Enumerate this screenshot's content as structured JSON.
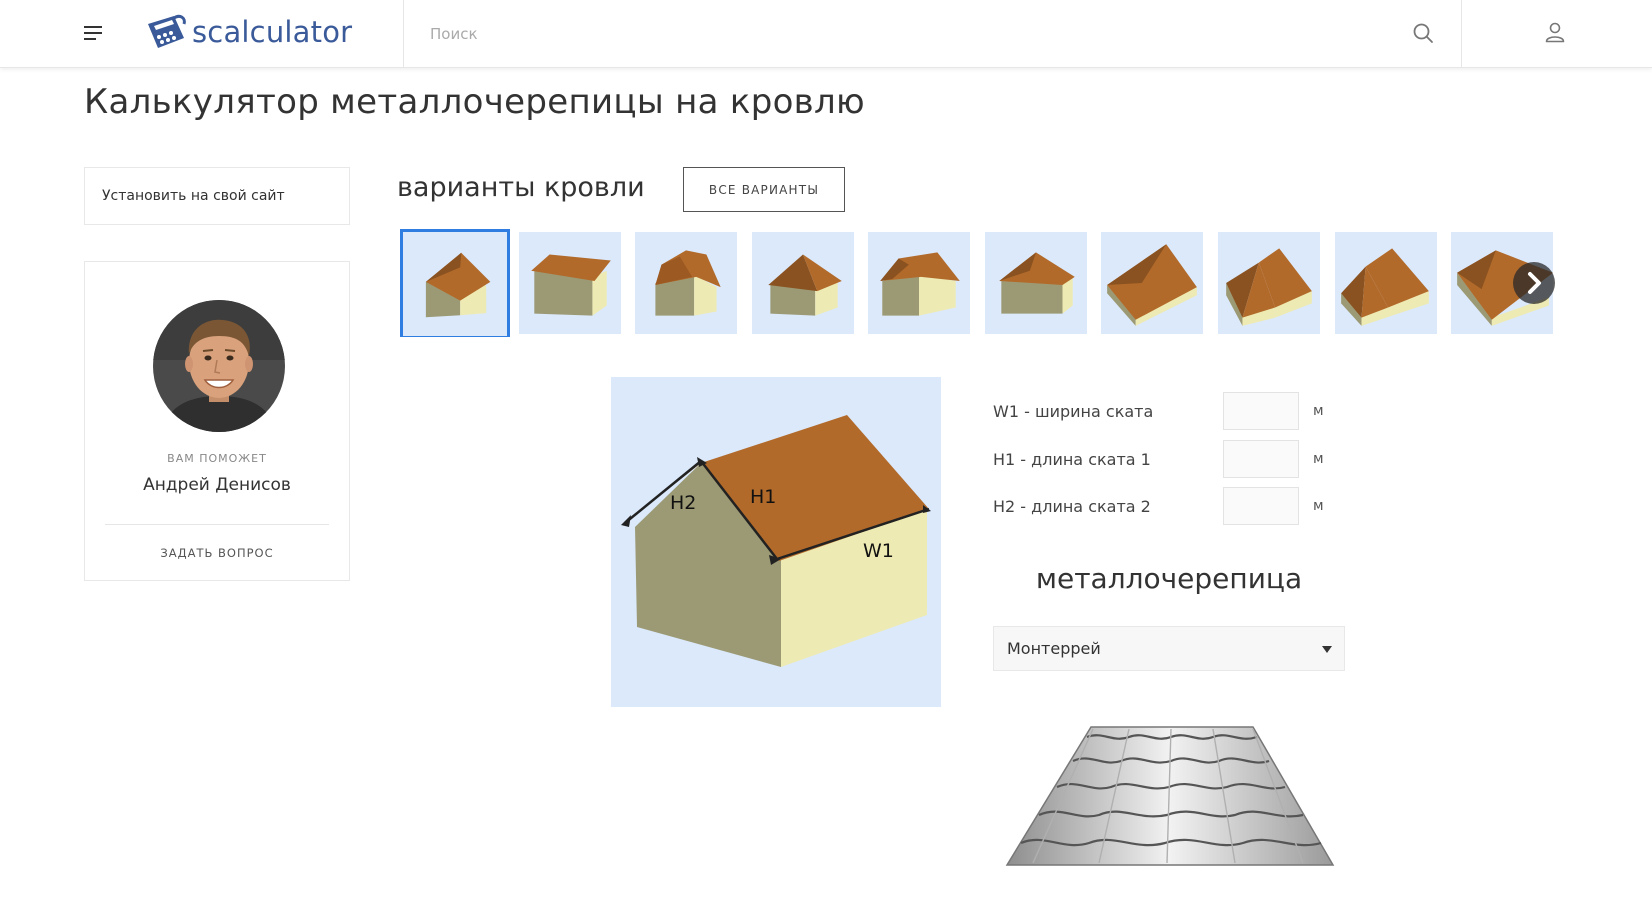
{
  "header": {
    "logo_text": "scalculator",
    "search_placeholder": "Поиск"
  },
  "page": {
    "title": "Калькулятор металлочерепицы на кровлю"
  },
  "sidebar": {
    "install_label": "Установить на свой сайт",
    "helper_label": "ВАМ ПОМОЖЕТ",
    "helper_name": "Андрей Денисов",
    "ask_label": "ЗАДАТЬ ВОПРОС"
  },
  "variants": {
    "title": "варианты кровли",
    "all_button": "ВСЕ ВАРИАНТЫ",
    "selected_index": 0,
    "count": 10
  },
  "diagram": {
    "labels": [
      "H2",
      "H1",
      "W1"
    ]
  },
  "form": {
    "rows": [
      {
        "label": "W1 - ширина ската",
        "value": "",
        "unit": "м"
      },
      {
        "label": "H1 - длина ската 1",
        "value": "",
        "unit": "м"
      },
      {
        "label": "H2 - длина ската 2",
        "value": "",
        "unit": "м"
      }
    ]
  },
  "material": {
    "title": "металлочерепица",
    "selected": "Монтеррей"
  },
  "colors": {
    "accent": "#2f7de1",
    "roof": "#b26a2a",
    "wall_dark": "#9c9a75",
    "wall_light": "#eeeab3",
    "thumb_bg": "#dbe9fb",
    "logo": "#3a5a9a"
  }
}
